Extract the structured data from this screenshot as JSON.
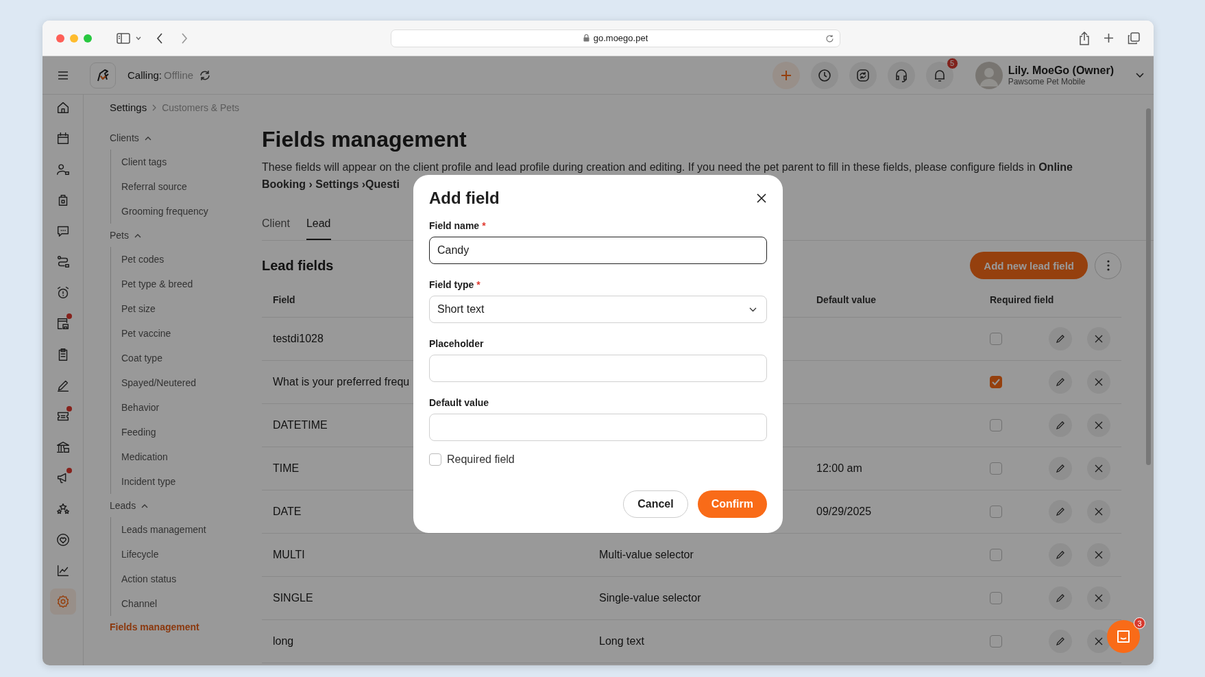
{
  "browser": {
    "url": "go.moego.pet"
  },
  "header": {
    "calling_label": "Calling:",
    "calling_status": "Offline",
    "notifications": "5",
    "user_name": "Lily. MoeGo (Owner)",
    "business": "Pawsome Pet Mobile"
  },
  "rail": [
    {
      "kind": "home",
      "badge": false,
      "selected": false
    },
    {
      "kind": "calendar",
      "badge": false,
      "selected": false
    },
    {
      "kind": "person",
      "badge": false,
      "selected": false
    },
    {
      "kind": "bag",
      "badge": false,
      "selected": false
    },
    {
      "kind": "chat",
      "badge": false,
      "selected": false
    },
    {
      "kind": "route",
      "badge": false,
      "selected": false
    },
    {
      "kind": "alarm",
      "badge": false,
      "selected": false
    },
    {
      "kind": "store",
      "badge": true,
      "selected": false
    },
    {
      "kind": "clipboard",
      "badge": false,
      "selected": false
    },
    {
      "kind": "pen",
      "badge": false,
      "selected": false
    },
    {
      "kind": "ticket",
      "badge": true,
      "selected": false
    },
    {
      "kind": "bank",
      "badge": false,
      "selected": false
    },
    {
      "kind": "megaphone",
      "badge": true,
      "selected": false
    },
    {
      "kind": "stars",
      "badge": false,
      "selected": false
    },
    {
      "kind": "heart",
      "badge": false,
      "selected": false
    },
    {
      "kind": "chart",
      "badge": false,
      "selected": false
    },
    {
      "kind": "settings",
      "badge": false,
      "selected": true
    }
  ],
  "breadcrumb": [
    "Settings",
    "Customers & Pets"
  ],
  "nav": [
    {
      "kind": "group",
      "label": "Clients",
      "expanded": true,
      "children": [
        {
          "label": "Client tags",
          "selected": false
        },
        {
          "label": "Referral source",
          "selected": false
        },
        {
          "label": "Grooming frequency",
          "selected": false
        }
      ]
    },
    {
      "kind": "group",
      "label": "Pets",
      "expanded": true,
      "children": [
        {
          "label": "Pet codes",
          "selected": false
        },
        {
          "label": "Pet type & breed",
          "selected": false
        },
        {
          "label": "Pet size",
          "selected": false
        },
        {
          "label": "Pet vaccine",
          "selected": false
        },
        {
          "label": "Coat type",
          "selected": false
        },
        {
          "label": "Spayed/Neutered",
          "selected": false
        },
        {
          "label": "Behavior",
          "selected": false
        },
        {
          "label": "Feeding",
          "selected": false
        },
        {
          "label": "Medication",
          "selected": false
        },
        {
          "label": "Incident type",
          "selected": false
        }
      ]
    },
    {
      "kind": "group",
      "label": "Leads",
      "expanded": true,
      "children": [
        {
          "label": "Leads management",
          "selected": false
        },
        {
          "label": "Lifecycle",
          "selected": false
        },
        {
          "label": "Action status",
          "selected": false
        },
        {
          "label": "Channel",
          "selected": false
        }
      ]
    },
    {
      "kind": "link",
      "label": "Fields management",
      "selected": true
    }
  ],
  "page": {
    "title": "Fields management",
    "description": "These fields will appear on the client profile and lead profile during creation and editing. If you need the pet parent to fill in these fields, please configure fields in **Online Booking › Settings ›Questi**"
  },
  "tabs": [
    {
      "label": "Client",
      "selected": false
    },
    {
      "label": "Lead",
      "selected": true
    }
  ],
  "section": {
    "title": "Lead fields",
    "add_button": "Add new lead field"
  },
  "table": {
    "columns": [
      "Field",
      "Default value",
      "Required field"
    ],
    "rows": [
      {
        "field": "testdi1028",
        "required": false
      },
      {
        "field": "What is your preferred frequ",
        "required": true
      },
      {
        "field": "DATETIME",
        "required": false
      },
      {
        "field": "TIME",
        "default_value": "12:00 am",
        "required": false
      },
      {
        "field": "DATE",
        "default_value": "09/29/2025",
        "required": false
      },
      {
        "field": "MULTI",
        "type": "Multi-value selector",
        "required": false
      },
      {
        "field": "SINGLE",
        "type": "Single-value selector",
        "required": false
      },
      {
        "field": "long",
        "type": "Long text",
        "required": false
      }
    ]
  },
  "chat_badge": "3",
  "modal": {
    "title": "Add field",
    "fields": [
      {
        "kind": "text",
        "label": "Field name",
        "mark": "*",
        "value": "Candy",
        "focused": true
      },
      {
        "kind": "select",
        "label": "Field type",
        "mark": "*",
        "value": "Short text",
        "focused": false
      },
      {
        "kind": "text",
        "label": "Placeholder",
        "focused": false
      },
      {
        "kind": "text",
        "label": "Default value",
        "focused": false
      }
    ],
    "required": {
      "label": "Required field",
      "checked": false
    },
    "cancel": "Cancel",
    "confirm": "Confirm"
  }
}
